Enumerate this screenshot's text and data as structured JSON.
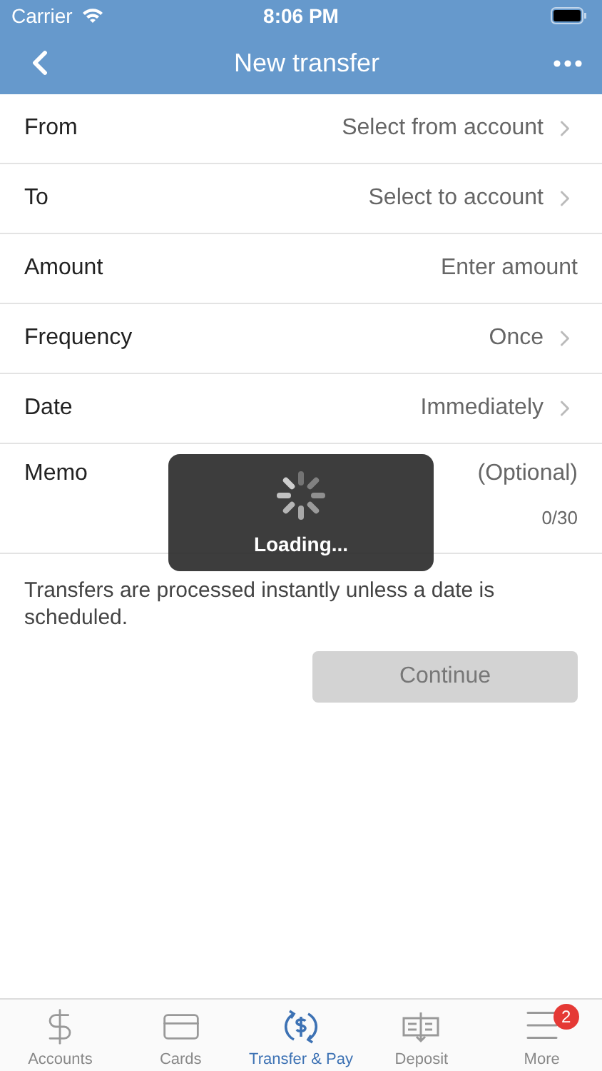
{
  "status_bar": {
    "carrier": "Carrier",
    "time": "8:06 PM"
  },
  "nav": {
    "title": "New transfer"
  },
  "form_rows": [
    {
      "kind": "select",
      "label": "From",
      "value": "Select from account"
    },
    {
      "kind": "select",
      "label": "To",
      "value": "Select to account"
    },
    {
      "kind": "input",
      "label": "Amount",
      "placeholder": "Enter amount"
    },
    {
      "kind": "select",
      "label": "Frequency",
      "value": "Once"
    },
    {
      "kind": "select",
      "label": "Date",
      "value": "Immediately"
    },
    {
      "kind": "memo",
      "label": "Memo",
      "placeholder": "(Optional)",
      "counter": "0/30"
    }
  ],
  "note": "Transfers are processed instantly unless a date is scheduled.",
  "continue_button": {
    "label": "Continue",
    "disabled": true
  },
  "loading": {
    "label": "Loading..."
  },
  "tab_bar": [
    {
      "label": "Accounts",
      "selected": false
    },
    {
      "label": "Cards",
      "selected": false
    },
    {
      "label": "Transfer & Pay",
      "selected": true
    },
    {
      "label": "Deposit",
      "selected": false
    },
    {
      "label": "More",
      "selected": false,
      "badge": "2"
    }
  ]
}
